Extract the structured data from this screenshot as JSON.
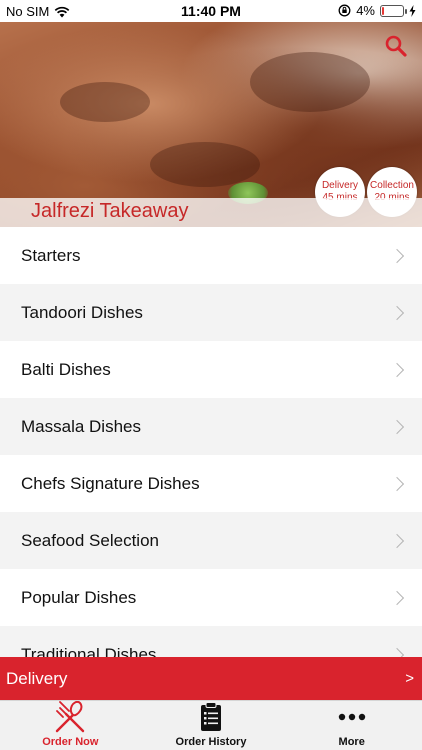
{
  "status_bar": {
    "carrier": "No SIM",
    "time": "11:40 PM",
    "battery_percent": "4%",
    "battery_level": 0.04
  },
  "hero": {
    "restaurant_name": "Jalfrezi Takeaway",
    "search_icon": "search-icon",
    "delivery": {
      "label": "Delivery",
      "time": "45 mins"
    },
    "collection": {
      "label": "Collection",
      "time": "20 mins"
    }
  },
  "menu": {
    "items": [
      {
        "label": "Starters"
      },
      {
        "label": "Tandoori Dishes"
      },
      {
        "label": "Balti Dishes"
      },
      {
        "label": "Massala Dishes"
      },
      {
        "label": "Chefs Signature Dishes"
      },
      {
        "label": "Seafood Selection"
      },
      {
        "label": "Popular Dishes"
      },
      {
        "label": "Traditional Dishes"
      }
    ]
  },
  "delivery_bar": {
    "label": "Delivery",
    "arrow": ">"
  },
  "tab_bar": {
    "tabs": [
      {
        "label": "Order Now",
        "icon": "fork-knife-icon",
        "active": true
      },
      {
        "label": "Order History",
        "icon": "clipboard-icon",
        "active": false
      },
      {
        "label": "More",
        "icon": "more-dots-icon",
        "active": false
      }
    ]
  },
  "colors": {
    "accent": "#d9232d",
    "brand_text": "#c62828"
  }
}
